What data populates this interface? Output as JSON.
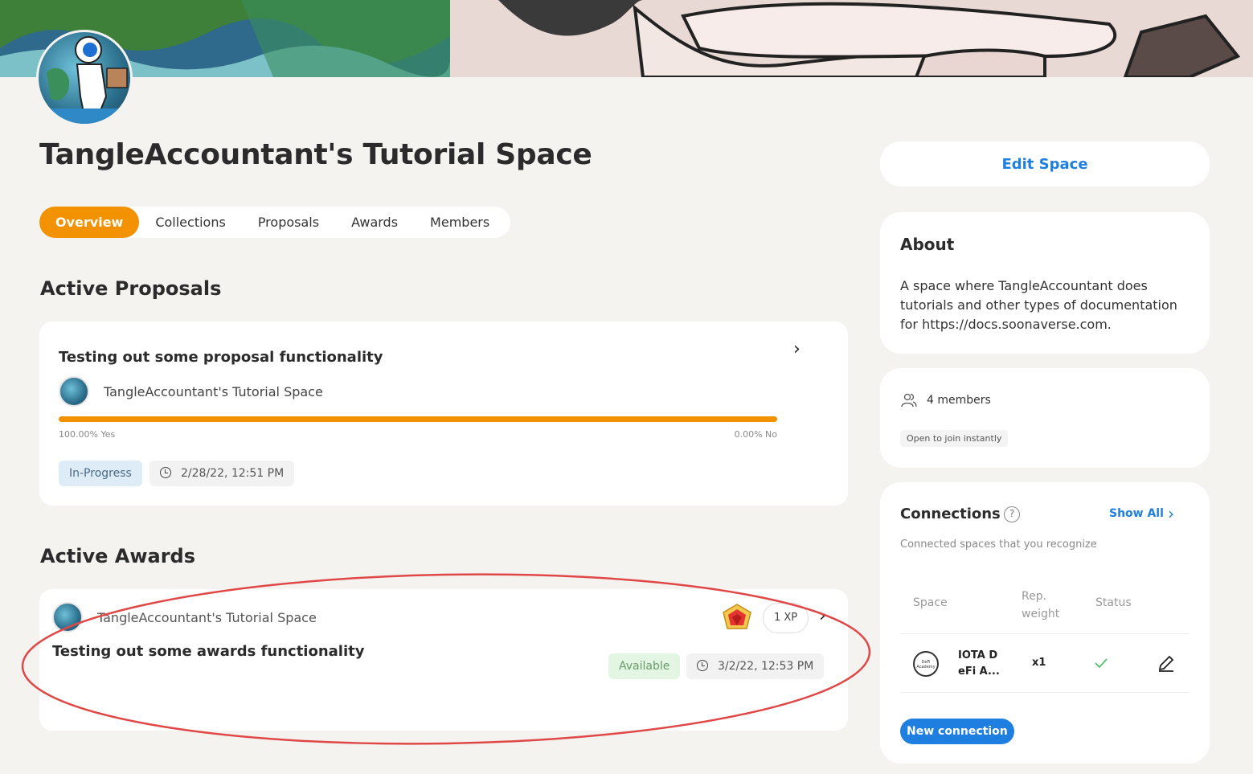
{
  "page": {
    "title": "TangleAccountant's Tutorial Space"
  },
  "tabs": [
    {
      "label": "Overview",
      "active": true
    },
    {
      "label": "Collections",
      "active": false
    },
    {
      "label": "Proposals",
      "active": false
    },
    {
      "label": "Awards",
      "active": false
    },
    {
      "label": "Members",
      "active": false
    }
  ],
  "proposals": {
    "heading": "Active Proposals",
    "item": {
      "title": "Testing out some proposal functionality",
      "space": "TangleAccountant's Tutorial Space",
      "yes_label": "100.00% Yes",
      "no_label": "0.00% No",
      "yes_fraction": 1.0,
      "status": "In-Progress",
      "date": "2/28/22, 12:51 PM"
    }
  },
  "awards": {
    "heading": "Active Awards",
    "item": {
      "space": "TangleAccountant's Tutorial Space",
      "title": "Testing out some awards functionality",
      "xp": "1 XP",
      "status": "Available",
      "date": "3/2/22, 12:53 PM"
    }
  },
  "sidebar": {
    "edit_button": "Edit Space",
    "about": {
      "title": "About",
      "text": "A space where TangleAccountant does tutorials and other types of documentation for https://docs.soonaverse.com."
    },
    "members": {
      "count": "4 members",
      "join_badge": "Open to join instantly"
    },
    "connections": {
      "title": "Connections",
      "help": "?",
      "show_all": "Show All",
      "subtitle": "Connected spaces that you recognize",
      "columns": {
        "space": "Space",
        "rep_weight": "Rep. weight",
        "status": "Status"
      },
      "row": {
        "name": "IOTA DeFi A...",
        "logo_text": "DeFi Academy",
        "weight": "x1"
      },
      "new_button": "New connection"
    }
  },
  "colors": {
    "accent": "#f39200",
    "link": "#1e7fe0",
    "in_progress_bg": "#ddecf7",
    "available_bg": "#e3f5e3",
    "annotation": "#e04848"
  }
}
